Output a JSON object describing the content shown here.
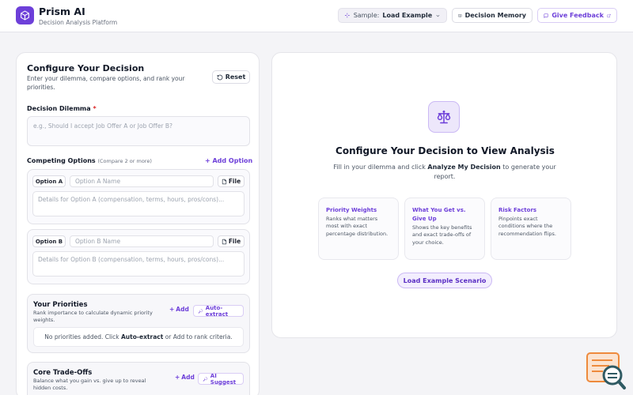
{
  "header": {
    "app_title": "Prism AI",
    "app_subtitle": "Decision Analysis Platform",
    "sample_label": "Sample:",
    "sample_value": "Load Example",
    "memory_label": "Decision Memory",
    "feedback_label": "Give Feedback"
  },
  "config": {
    "title": "Configure Your Decision",
    "description": "Enter your dilemma, compare options, and rank your priorities.",
    "reset_label": "Reset",
    "dilemma_label": "Decision Dilemma",
    "dilemma_required": "*",
    "dilemma_placeholder": "e.g., Should I accept Job Offer A or Job Offer B?",
    "options_label": "Competing Options",
    "options_note": "(Compare 2 or more)",
    "add_option_label": "+ Add Option",
    "options": [
      {
        "tag": "Option A",
        "name_placeholder": "Option A Name",
        "file_label": "File",
        "details_placeholder": "Details for Option A (compensation, terms, hours, pros/cons)..."
      },
      {
        "tag": "Option B",
        "name_placeholder": "Option B Name",
        "file_label": "File",
        "details_placeholder": "Details for Option B (compensation, terms, hours, pros/cons)..."
      }
    ],
    "priorities": {
      "title": "Your Priorities",
      "description": "Rank importance to calculate dynamic priority weights.",
      "add_label": "Add",
      "extract_label": "Auto-extract",
      "empty_prefix": "No priorities added. Click",
      "empty_bold": "Auto-extract",
      "empty_suffix": "or Add to rank criteria."
    },
    "tradeoffs": {
      "title": "Core Trade-Offs",
      "description": "Balance what you gain vs. give up to reveal hidden costs.",
      "add_label": "Add",
      "suggest_label": "AI Suggest"
    }
  },
  "analysis": {
    "title": "Configure Your Decision to View Analysis",
    "desc_prefix": "Fill in your dilemma and click",
    "desc_bold": "Analyze My Decision",
    "desc_suffix": "to generate your report.",
    "features": [
      {
        "title": "Priority Weights",
        "description": "Ranks what matters most with exact percentage distribution."
      },
      {
        "title": "What You Get vs. Give Up",
        "description": "Shows the key benefits and exact trade-offs of your choice."
      },
      {
        "title": "Risk Factors",
        "description": "Pinpoints exact conditions where the recommendation flips."
      }
    ],
    "load_example_label": "Load Example Scenario"
  },
  "colors": {
    "accent": "#6d3fd9",
    "required": "#dc2626",
    "helper_orange": "#ee8a3c",
    "helper_teal": "#2f5a63"
  }
}
